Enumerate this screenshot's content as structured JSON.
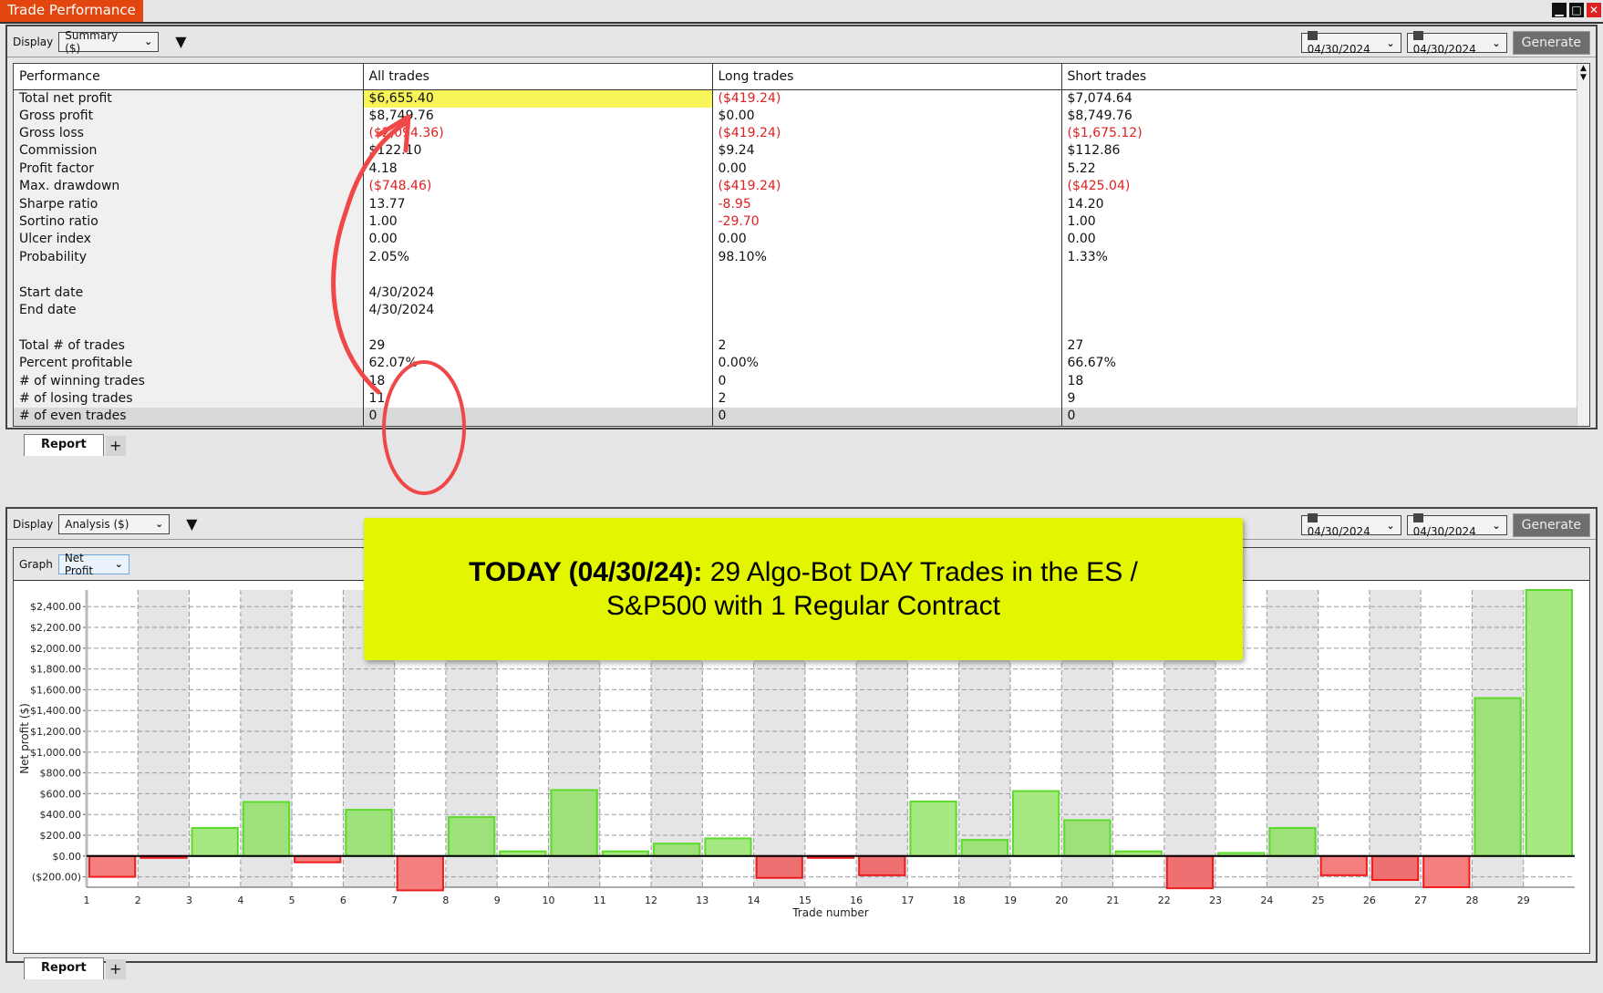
{
  "window": {
    "title": "Trade Performance",
    "controls": [
      "minimize",
      "maximize",
      "close"
    ]
  },
  "top_panel": {
    "display_label": "Display",
    "display_value": "Summary ($)",
    "date_from": "04/30/2024",
    "date_to": "04/30/2024",
    "generate_label": "Generate",
    "columns": [
      "Performance",
      "All trades",
      "Long trades",
      "Short trades"
    ],
    "rows": [
      {
        "metric": "Total net profit",
        "all": "$6,655.40",
        "long": "($419.24)",
        "short": "$7,074.64",
        "neg": [
          false,
          true,
          false
        ]
      },
      {
        "metric": "Gross profit",
        "all": "$8,749.76",
        "long": "$0.00",
        "short": "$8,749.76",
        "neg": [
          false,
          false,
          false
        ]
      },
      {
        "metric": "Gross loss",
        "all": "($2,094.36)",
        "long": "($419.24)",
        "short": "($1,675.12)",
        "neg": [
          true,
          true,
          true
        ]
      },
      {
        "metric": "Commission",
        "all": "$122.10",
        "long": "$9.24",
        "short": "$112.86",
        "neg": [
          false,
          false,
          false
        ]
      },
      {
        "metric": "Profit factor",
        "all": "4.18",
        "long": "0.00",
        "short": "5.22",
        "neg": [
          false,
          false,
          false
        ]
      },
      {
        "metric": "Max. drawdown",
        "all": "($748.46)",
        "long": "($419.24)",
        "short": "($425.04)",
        "neg": [
          true,
          true,
          true
        ]
      },
      {
        "metric": "Sharpe ratio",
        "all": "13.77",
        "long": "-8.95",
        "short": "14.20",
        "neg": [
          false,
          true,
          false
        ]
      },
      {
        "metric": "Sortino ratio",
        "all": "1.00",
        "long": "-29.70",
        "short": "1.00",
        "neg": [
          false,
          true,
          false
        ]
      },
      {
        "metric": "Ulcer index",
        "all": "0.00",
        "long": "0.00",
        "short": "0.00",
        "neg": [
          false,
          false,
          false
        ]
      },
      {
        "metric": "Probability",
        "all": "2.05%",
        "long": "98.10%",
        "short": "1.33%",
        "neg": [
          false,
          false,
          false
        ]
      },
      {
        "metric": "",
        "all": "",
        "long": "",
        "short": "",
        "neg": [
          false,
          false,
          false
        ]
      },
      {
        "metric": "Start date",
        "all": "4/30/2024",
        "long": "",
        "short": "",
        "neg": [
          false,
          false,
          false
        ]
      },
      {
        "metric": "End date",
        "all": "4/30/2024",
        "long": "",
        "short": "",
        "neg": [
          false,
          false,
          false
        ]
      },
      {
        "metric": "",
        "all": "",
        "long": "",
        "short": "",
        "neg": [
          false,
          false,
          false
        ]
      },
      {
        "metric": "Total # of trades",
        "all": "29",
        "long": "2",
        "short": "27",
        "neg": [
          false,
          false,
          false
        ]
      },
      {
        "metric": "Percent profitable",
        "all": "62.07%",
        "long": "0.00%",
        "short": "66.67%",
        "neg": [
          false,
          false,
          false
        ]
      },
      {
        "metric": "# of winning trades",
        "all": "18",
        "long": "0",
        "short": "18",
        "neg": [
          false,
          false,
          false
        ]
      },
      {
        "metric": "# of losing trades",
        "all": "11",
        "long": "2",
        "short": "9",
        "neg": [
          false,
          false,
          false
        ]
      },
      {
        "metric": "# of even trades",
        "all": "0",
        "long": "0",
        "short": "0",
        "neg": [
          false,
          false,
          false
        ]
      }
    ],
    "tab_label": "Report",
    "add_tab": "+"
  },
  "bottom_panel": {
    "display_label": "Display",
    "display_value": "Analysis ($)",
    "date_from": "04/30/2024",
    "date_to": "04/30/2024",
    "generate_label": "Generate",
    "graph_label": "Graph",
    "graph_value": "Net Profit",
    "tab_label": "Report",
    "add_tab": "+"
  },
  "annotation": {
    "bold": "TODAY (04/30/24):",
    "text": " 29 Algo-Bot DAY Trades in the ES / S&P500 with 1 Regular Contract"
  },
  "colors": {
    "title_tab": "#e2460e",
    "profit_bar": "#a6e882",
    "profit_border": "#5cdb2a",
    "loss_bar": "#f47f7f",
    "loss_border": "#ee1c1c",
    "negative_text": "#e02020",
    "highlight": "#f8f55a",
    "annotation_bg": "#e3f600",
    "annotation_stroke": "#f04848"
  },
  "chart_data": {
    "type": "bar",
    "title": "",
    "xlabel": "Trade number",
    "ylabel": "Net profit ($)",
    "ylim": [
      -300,
      2560
    ],
    "yticks": [
      -200,
      0,
      200,
      400,
      600,
      800,
      1000,
      1200,
      1400,
      1600,
      1800,
      2000,
      2200,
      2400
    ],
    "ytick_labels": [
      "($200.00)",
      "$0.00",
      "$200.00",
      "$400.00",
      "$600.00",
      "$800.00",
      "$1,000.00",
      "$1,200.00",
      "$1,400.00",
      "$1,600.00",
      "$1,800.00",
      "$2,000.00",
      "$2,200.00",
      "$2,400.00"
    ],
    "grid": true,
    "categories": [
      "1",
      "2",
      "3",
      "4",
      "5",
      "6",
      "7",
      "8",
      "9",
      "10",
      "11",
      "12",
      "13",
      "14",
      "15",
      "16",
      "17",
      "18",
      "19",
      "20",
      "21",
      "22",
      "23",
      "24",
      "25",
      "26",
      "27",
      "28",
      "29"
    ],
    "values": [
      -200,
      -15,
      270,
      520,
      -60,
      445,
      -330,
      375,
      45,
      635,
      45,
      120,
      170,
      -210,
      -10,
      -185,
      525,
      155,
      625,
      345,
      45,
      -310,
      30,
      270,
      -185,
      -230,
      -300,
      1520,
      2560
    ]
  }
}
